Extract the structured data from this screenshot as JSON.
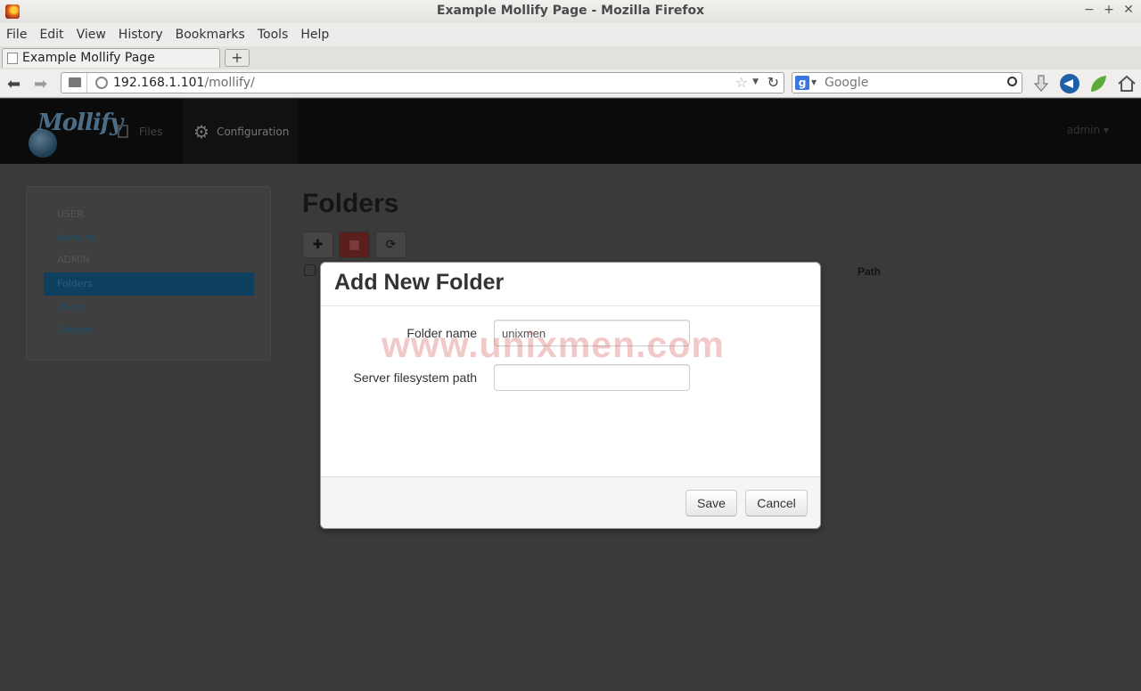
{
  "window": {
    "title": "Example Mollify Page - Mozilla Firefox",
    "controls": [
      "−",
      "+",
      "✕"
    ]
  },
  "menubar": [
    "File",
    "Edit",
    "View",
    "History",
    "Bookmarks",
    "Tools",
    "Help"
  ],
  "tabs": {
    "active_label": "Example Mollify Page",
    "new_tab_label": "+"
  },
  "address_bar": {
    "host": "192.168.1.101",
    "path": "/mollify/"
  },
  "search_bar": {
    "engine_letter": "g",
    "placeholder": "Google"
  },
  "app": {
    "logo_text": "Mollify",
    "nav": {
      "files": "Files",
      "configuration": "Configuration"
    },
    "user_menu": "admin ▾",
    "sidebar": {
      "items": [
        {
          "label": "USER",
          "kind": "header"
        },
        {
          "label": "Account",
          "kind": "link"
        },
        {
          "label": "ADMIN",
          "kind": "header"
        },
        {
          "label": "Folders",
          "kind": "active"
        },
        {
          "label": "Users",
          "kind": "link"
        },
        {
          "label": "Groups",
          "kind": "link"
        }
      ]
    },
    "main": {
      "title": "Folders",
      "toolbar_icons": [
        "plus-icon",
        "trash-icon",
        "refresh-icon"
      ],
      "column_header_path": "Path"
    }
  },
  "modal": {
    "title": "Add New Folder",
    "fields": {
      "folder_name": {
        "label": "Folder name",
        "value": "unixmen",
        "placeholder": ""
      },
      "server_path": {
        "label": "Server filesystem path",
        "value": "",
        "placeholder": ""
      }
    },
    "watermark": "www.unixmen.com",
    "save_label": "Save",
    "cancel_label": "Cancel"
  }
}
